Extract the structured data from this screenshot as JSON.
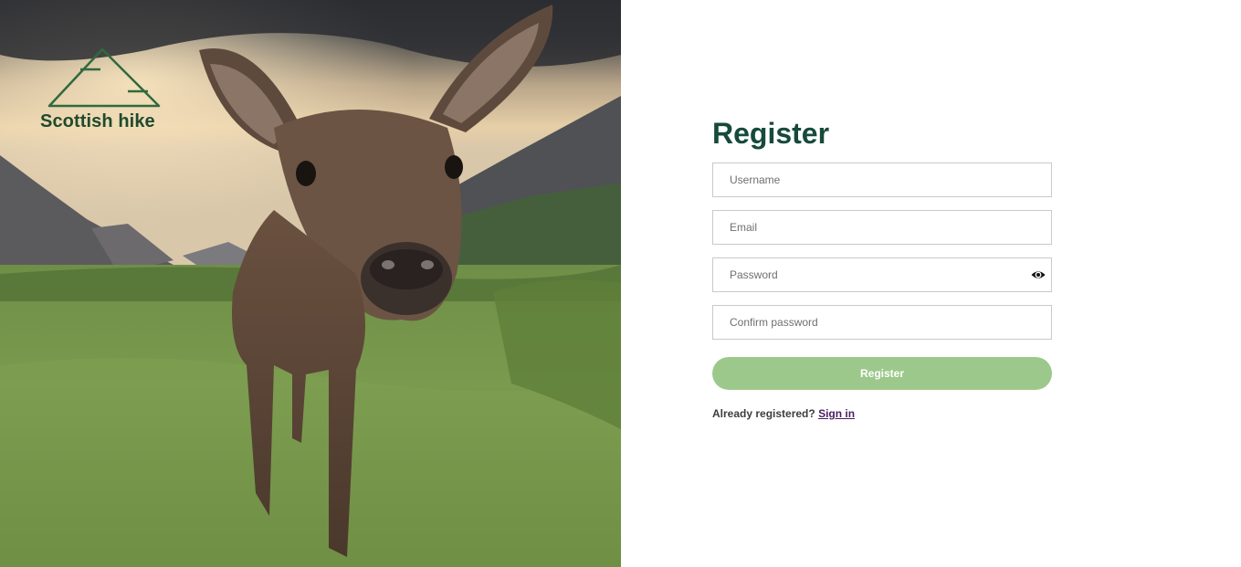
{
  "brand": {
    "name": "Scottish hike",
    "logo_icon": "mountain-logo-icon",
    "color": "#1f4a2e"
  },
  "hero": {
    "image_subject": "deer-in-highland-glen"
  },
  "form": {
    "title": "Register",
    "title_color": "#164a3b",
    "fields": {
      "username": {
        "placeholder": "Username",
        "value": ""
      },
      "email": {
        "placeholder": "Email",
        "value": ""
      },
      "password": {
        "placeholder": "Password",
        "value": "",
        "toggle_icon": "eye-icon"
      },
      "confirm_password": {
        "placeholder": "Confirm password",
        "value": ""
      }
    },
    "submit_label": "Register",
    "submit_color": "#9cc98b",
    "signin_prompt": "Already registered?",
    "signin_link": "Sign in",
    "link_color": "#4b1e63"
  }
}
